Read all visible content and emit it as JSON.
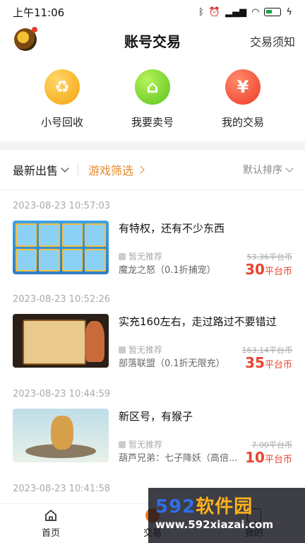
{
  "status_bar": {
    "time": "上午11:06",
    "battery": "61"
  },
  "header": {
    "title": "账号交易",
    "rules_link": "交易须知"
  },
  "actions": [
    {
      "label": "小号回收",
      "icon": "recycle-icon",
      "color": "#f5a20a"
    },
    {
      "label": "我要卖号",
      "icon": "shop-icon",
      "color": "#5cc51a"
    },
    {
      "label": "我的交易",
      "icon": "wallet-icon",
      "color": "#ef3a2a"
    }
  ],
  "filters": {
    "latest": "最新出售",
    "game_filter": "游戏筛选",
    "sort": "默认排序"
  },
  "listings": [
    {
      "time": "2023-08-23 10:57:03",
      "title": "有特权，还有不少东西",
      "recommend": "暂无推荐",
      "game": "魔龙之怒（0.1折捕宠）",
      "old_price": "53.36平台币",
      "price": "30",
      "unit": "平台币"
    },
    {
      "time": "2023-08-23 10:52:26",
      "title": "实充160左右，走过路过不要错过",
      "recommend": "暂无推荐",
      "game": "部落联盟（0.1折无限充）",
      "old_price": "163.14平台币",
      "price": "35",
      "unit": "平台币"
    },
    {
      "time": "2023-08-23 10:44:59",
      "title": "新区号，有猴子",
      "recommend": "暂无推荐",
      "game": "葫芦兄弟：七子降妖（高倍...",
      "old_price": "7.00平台币",
      "price": "10",
      "unit": "平台币"
    }
  ],
  "next_time": "2023-08-23 10:41:58",
  "tabs": [
    {
      "label": "首页",
      "icon": "home-icon"
    },
    {
      "label": "交易",
      "icon": "trade-icon"
    },
    {
      "label": "我的",
      "icon": "user-icon"
    }
  ],
  "watermark": {
    "line1_num": "592",
    "line1_cn": "软件园",
    "line2": "www.592xiazai.com"
  }
}
